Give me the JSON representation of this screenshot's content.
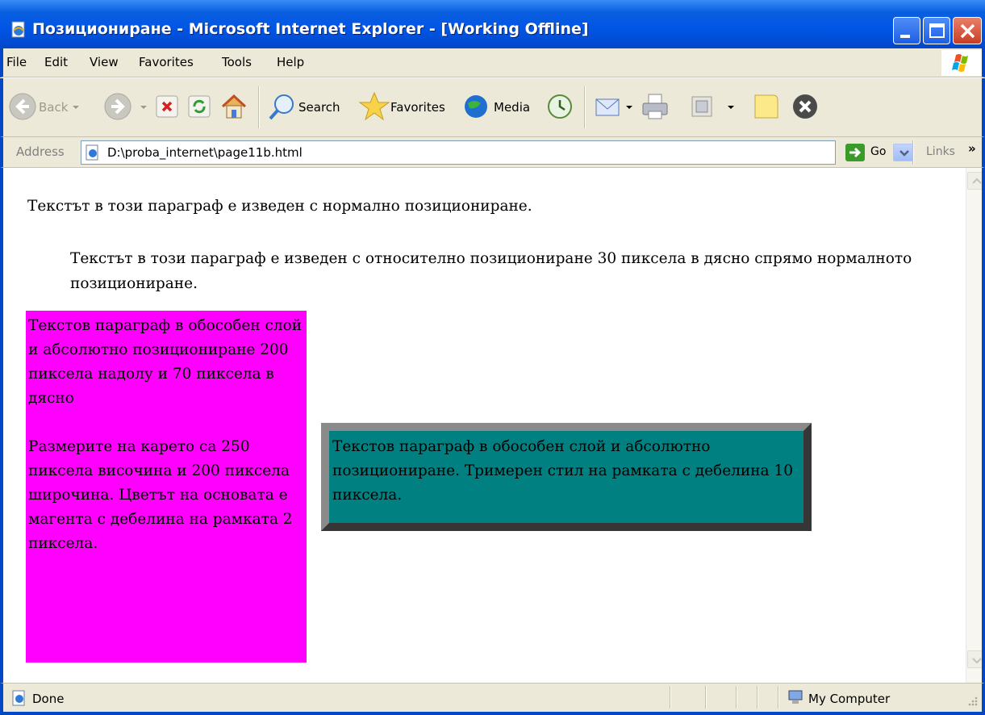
{
  "window": {
    "title": "Позициониране - Microsoft Internet Explorer - [Working Offline]"
  },
  "menu": {
    "items": [
      "File",
      "Edit",
      "View",
      "Favorites",
      "Tools",
      "Help"
    ]
  },
  "toolbar": {
    "back_label": "Back",
    "search_label": "Search",
    "favorites_label": "Favorites",
    "media_label": "Media"
  },
  "address": {
    "label": "Address",
    "url": "D:\\proba_internet\\page11b.html",
    "go_label": "Go",
    "links_label": "Links",
    "links_chevron": "»"
  },
  "page": {
    "p_normal": "Текстът в този параграф е изведен с нормално позициониране.",
    "p_relative": "Текстът в този параграф е изведен с относително позициониране 30 пиксела в дясно спрямо нормалното позициониране.",
    "magenta_p1": "Текстов параграф в обособен слой и абсолютно позициониране 200 пиксела надолу и 70 пиксела в дясно",
    "magenta_p2": "Размерите на карето са 250 пиксела височина и 200 пиксела широчина. Цветът на основата е магента с дебелина на рамката 2 пиксела.",
    "teal_p": "Текстов параграф в обособен слой и абсолютно позициониране. Тримерен стил на рамката с дебелина 10 пиксела."
  },
  "status": {
    "text": "Done",
    "zone": "My Computer"
  },
  "colors": {
    "titlebar": "#0055e5",
    "magenta_box": "#ff00ff",
    "teal_box": "#008080",
    "teal_border": "#8a8a8a",
    "chrome": "#ece9d8"
  },
  "icons": [
    "ie-page-icon",
    "minimize-icon",
    "maximize-icon",
    "close-icon",
    "windows-logo-icon",
    "back-icon",
    "forward-icon",
    "stop-icon",
    "refresh-icon",
    "home-icon",
    "search-icon",
    "favorites-star-icon",
    "media-icon",
    "history-icon",
    "mail-icon",
    "print-icon",
    "edit-icon",
    "discuss-icon",
    "messenger-icon",
    "go-arrow-icon",
    "status-page-icon",
    "my-computer-icon"
  ]
}
